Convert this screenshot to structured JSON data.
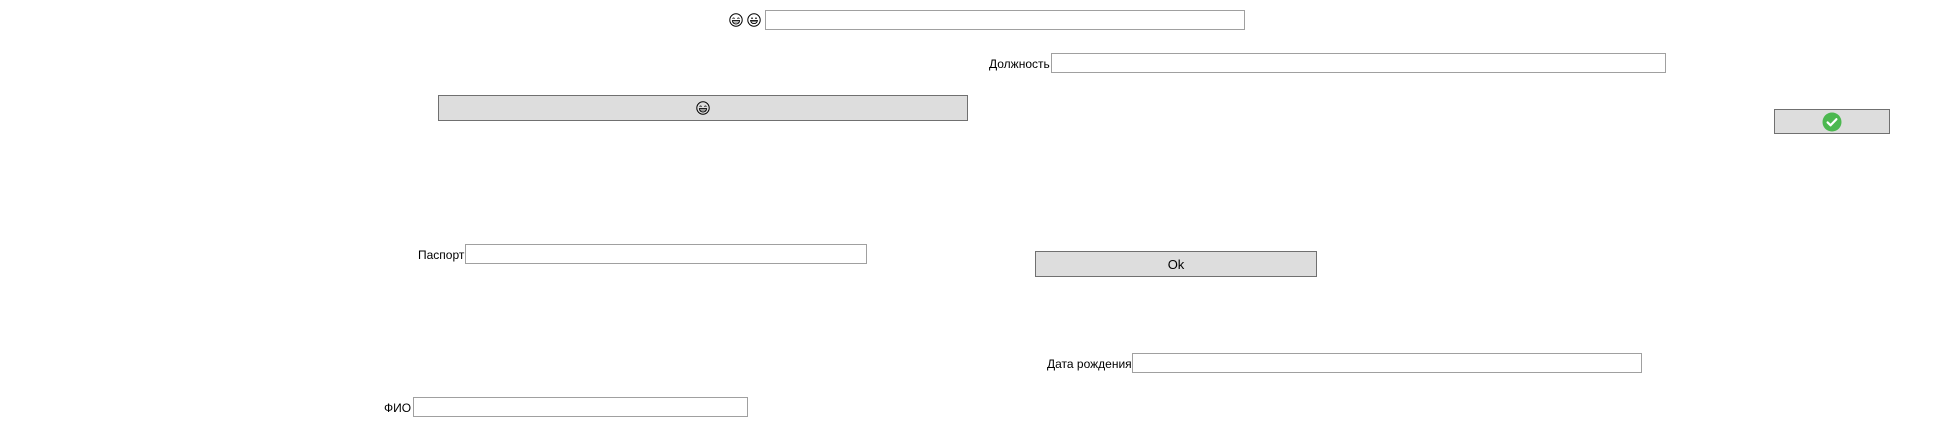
{
  "fields": {
    "top_field": {
      "value": ""
    },
    "position": {
      "label": "Должность",
      "value": ""
    },
    "passport": {
      "label": "Паспорт",
      "value": ""
    },
    "birth_date": {
      "label": "Дата рождения",
      "value": ""
    },
    "full_name": {
      "label": "ФИО",
      "value": ""
    }
  },
  "icons": {
    "top_face_1": "laughing-face-icon",
    "top_face_2": "grinning-face-icon",
    "wide_button_icon": "laughing-face-icon",
    "confirm_icon": "check-circle-icon"
  },
  "buttons": {
    "ok_label": "Ok"
  },
  "colors": {
    "button_bg": "#dddddd",
    "button_border": "#707070",
    "field_border": "#a0a0a0",
    "confirm_green": "#4cb850"
  }
}
